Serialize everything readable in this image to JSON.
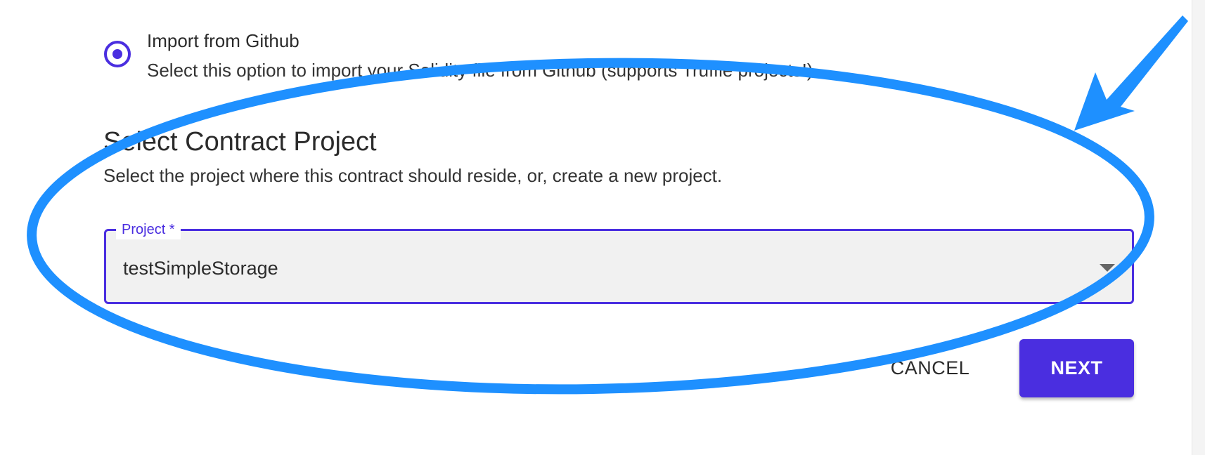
{
  "import_option": {
    "title": "Import from Github",
    "description": "Select this option to import your Solidity file from Github (supports Truffle projects!)",
    "selected": true
  },
  "section": {
    "title": "Select Contract Project",
    "description": "Select the project where this contract should reside, or, create a new project."
  },
  "project_field": {
    "label": "Project *",
    "value": "testSimpleStorage"
  },
  "actions": {
    "cancel_label": "CANCEL",
    "next_label": "NEXT"
  },
  "annotation": {
    "color": "#1e90ff",
    "shapes": [
      "ellipse-highlight",
      "pointer-arrow"
    ]
  },
  "colors": {
    "accent": "#4a2ee0",
    "field_background": "#f1f1f1"
  },
  "icons": {
    "radio": "radio-selected-icon",
    "dropdown": "dropdown-caret-icon"
  }
}
